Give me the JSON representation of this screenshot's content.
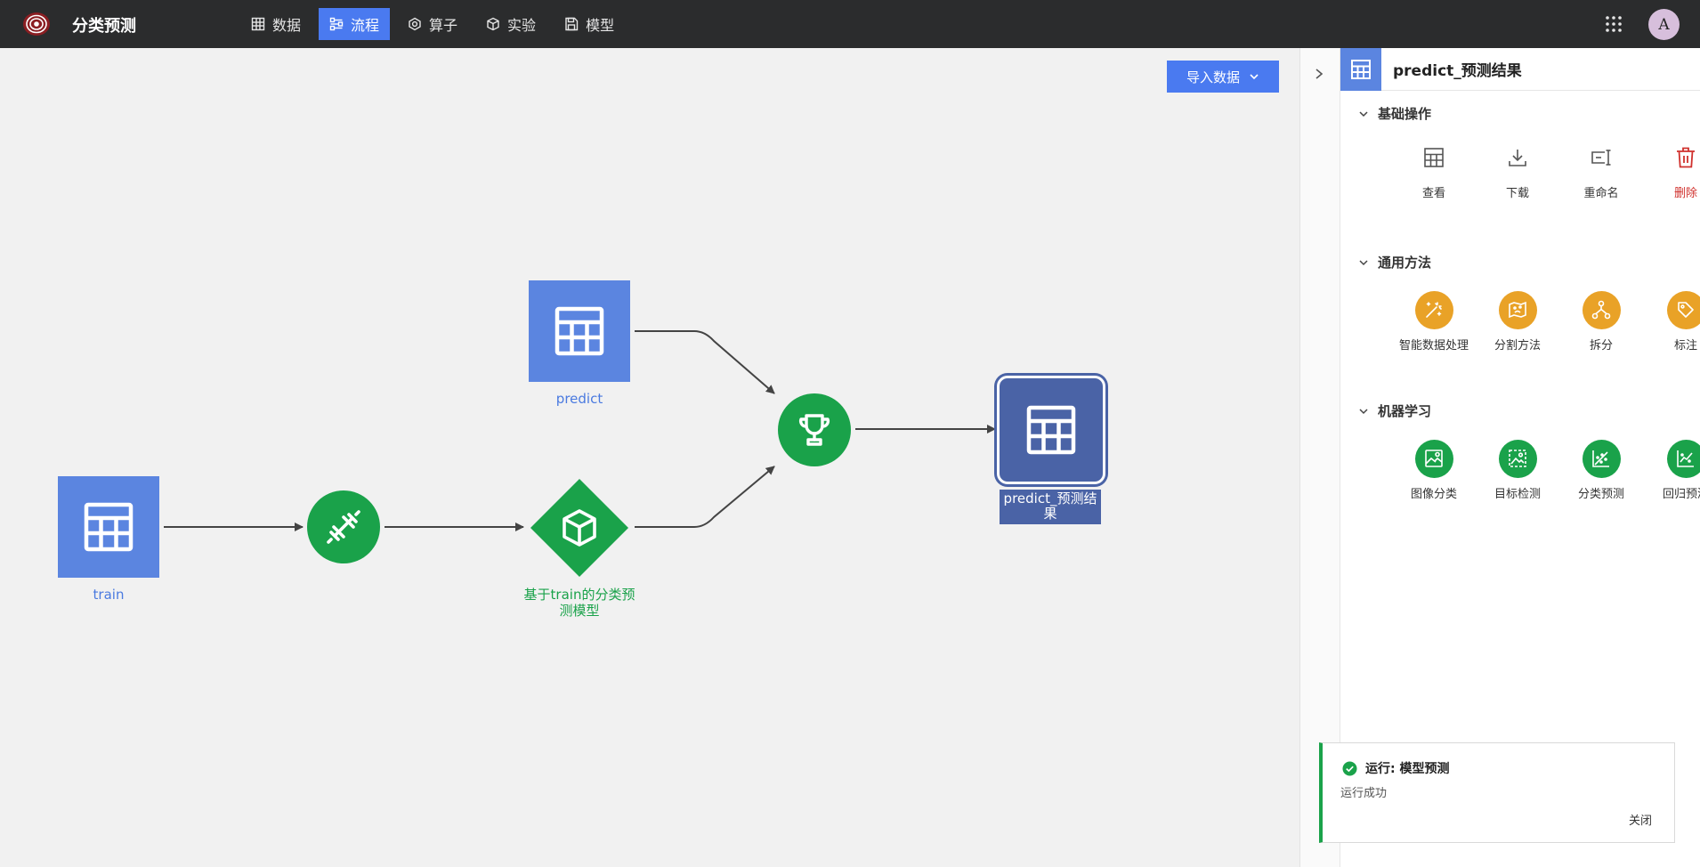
{
  "app": {
    "title": "分类预测"
  },
  "nav": [
    {
      "label": "数据",
      "icon": "table-icon"
    },
    {
      "label": "流程",
      "icon": "workflow-icon",
      "active": true
    },
    {
      "label": "算子",
      "icon": "operator-icon"
    },
    {
      "label": "实验",
      "icon": "cube-icon"
    },
    {
      "label": "模型",
      "icon": "save-icon"
    }
  ],
  "user": {
    "avatar_letter": "A"
  },
  "canvas": {
    "import_button": "导入数据",
    "nodes": {
      "train": "train",
      "predict": "predict",
      "model": "基于train的分类预测模型",
      "result": "predict_预测结果"
    }
  },
  "panel": {
    "title": "predict_预测结果",
    "sections": [
      {
        "title": "基础操作",
        "actions": [
          {
            "label": "查看",
            "icon": "table-icon"
          },
          {
            "label": "下载",
            "icon": "download-icon"
          },
          {
            "label": "重命名",
            "icon": "rename-icon"
          },
          {
            "label": "删除",
            "icon": "trash-icon"
          }
        ]
      },
      {
        "title": "通用方法",
        "actions": [
          {
            "label": "智能数据处理",
            "icon": "magic-wand-icon"
          },
          {
            "label": "分割方法",
            "icon": "map-icon"
          },
          {
            "label": "拆分",
            "icon": "split-icon"
          },
          {
            "label": "标注",
            "icon": "tag-icon"
          }
        ]
      },
      {
        "title": "机器学习",
        "actions": [
          {
            "label": "图像分类",
            "icon": "image-classify-icon"
          },
          {
            "label": "目标检测",
            "icon": "object-detect-icon"
          },
          {
            "label": "分类预测",
            "icon": "scatter-icon"
          },
          {
            "label": "回归预测",
            "icon": "line-chart-icon"
          }
        ]
      }
    ]
  },
  "toast": {
    "title": "运行: 模型预测",
    "body": "运行成功",
    "close": "关闭"
  },
  "colors": {
    "accent": "#4a7af0",
    "table_node": "#5b85e0",
    "green": "#1aa24a",
    "orange": "#e9a227",
    "selected": "#4a63a6",
    "danger": "#d0312d"
  }
}
